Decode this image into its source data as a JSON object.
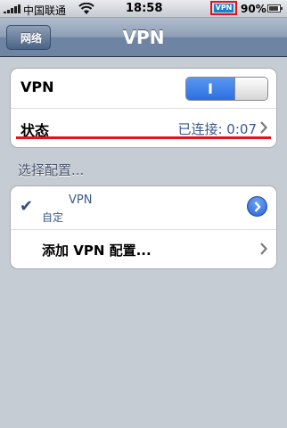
{
  "status_bar": {
    "carrier": "中国联通",
    "time": "18:58",
    "vpn_badge": "VPN",
    "battery": "90%",
    "battery_level": 0.9
  },
  "nav": {
    "back_label": "网络",
    "title": "VPN"
  },
  "vpn_group": {
    "vpn_label": "VPN",
    "toggle_on_label": "I",
    "toggle_state": "on",
    "status_label": "状态",
    "status_value": "已连接: 0:07"
  },
  "section_header": "选择配置...",
  "configs": {
    "items": [
      {
        "name": "VPN",
        "subtitle": "自定",
        "selected": true
      }
    ],
    "add_label": "添加 VPN 配置..."
  },
  "colors": {
    "accent": "#2b6fe3",
    "highlight": "#e0141a",
    "background": "#c5ccd4"
  }
}
